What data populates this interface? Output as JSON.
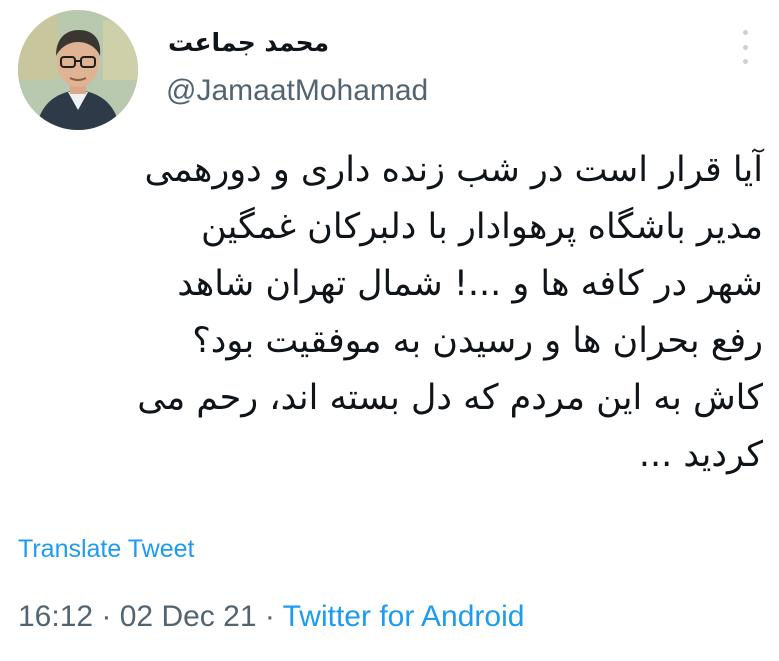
{
  "author": {
    "display_name": "محمد جماعت",
    "handle": "@JamaatMohamad",
    "avatar_icon": "profile-photo"
  },
  "tweet": {
    "lines": [
      "آیا قرار است در شب زنده داری و دورهمی",
      "مدیر باشگاه پرهوادار با دلبرکان غمگین",
      "شهر در کافه ها و ...! شمال تهران شاهد",
      "رفع بحران ها و رسیدن به موفقیت بود؟",
      "کاش به این مردم که دل بسته اند، رحم می",
      "کردید ..."
    ]
  },
  "actions": {
    "translate_label": "Translate Tweet",
    "more_icon": "more-vertical-icon"
  },
  "meta": {
    "time": "16:12",
    "sep1": " · ",
    "date": "02 Dec 21",
    "sep2": " · ",
    "source": "Twitter for Android"
  },
  "colors": {
    "link": "#1d9bf0",
    "muted": "#536471",
    "text": "#0f1419"
  }
}
